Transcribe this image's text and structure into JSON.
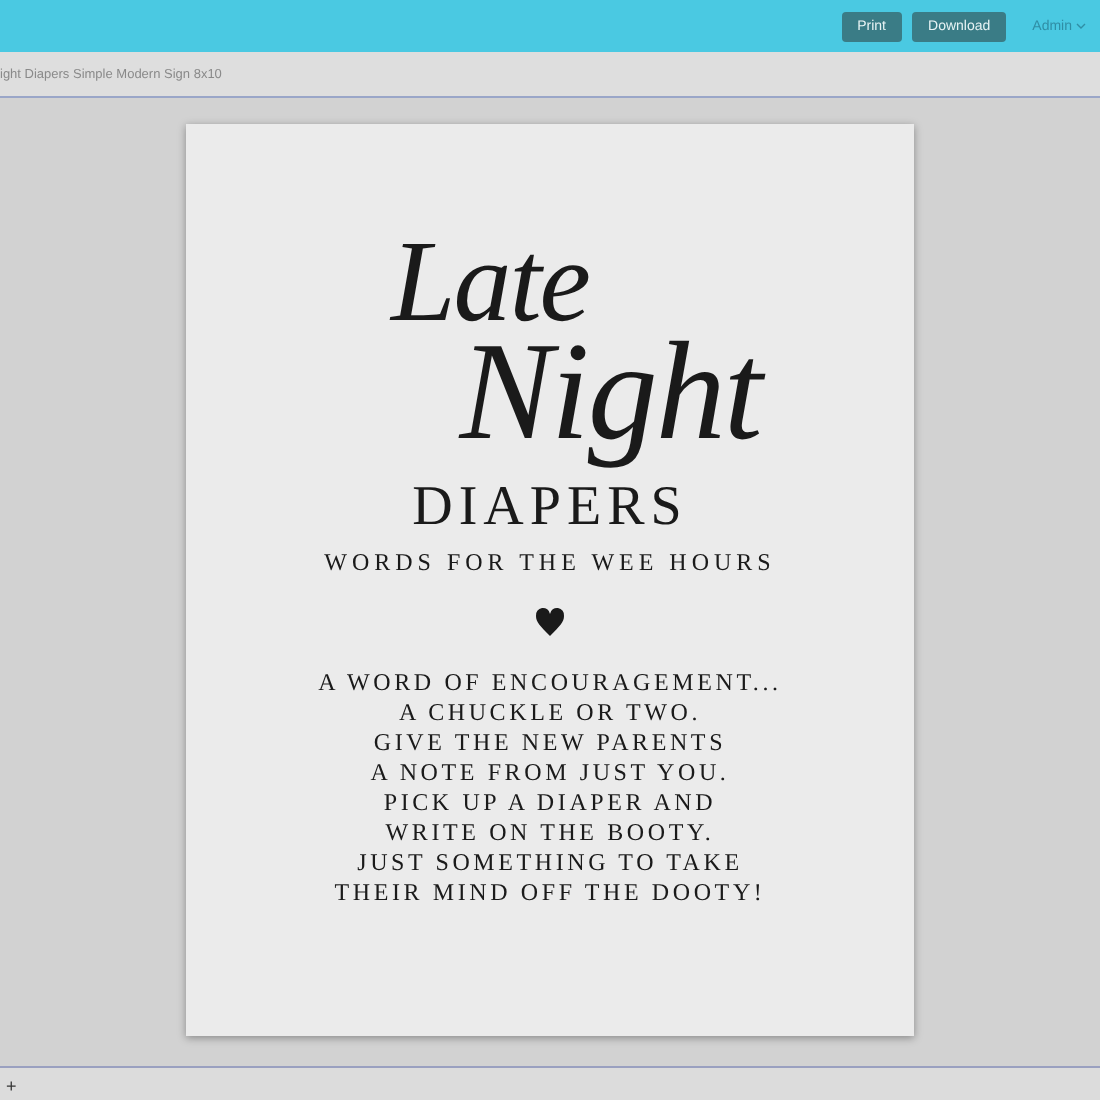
{
  "top_bar": {
    "buttons": [
      "Print",
      "Download"
    ],
    "user": "Admin"
  },
  "document_bar": {
    "title": "ight Diapers Simple Modern Sign 8x10"
  },
  "sign": {
    "script_title": [
      "Late",
      "Night"
    ],
    "title": "DIAPERS",
    "subtitle": "WORDS FOR THE WEE HOURS",
    "lines": [
      "A WORD OF ENCOURAGEMENT...",
      "A CHUCKLE OR TWO.",
      "GIVE THE NEW PARENTS",
      "A NOTE FROM JUST YOU.",
      "PICK UP A DIAPER AND",
      "WRITE ON THE BOOTY.",
      "JUST SOMETHING TO TAKE",
      "THEIR MIND OFF THE DOOTY!"
    ]
  },
  "bottom_bar": {
    "add_label": "+"
  }
}
